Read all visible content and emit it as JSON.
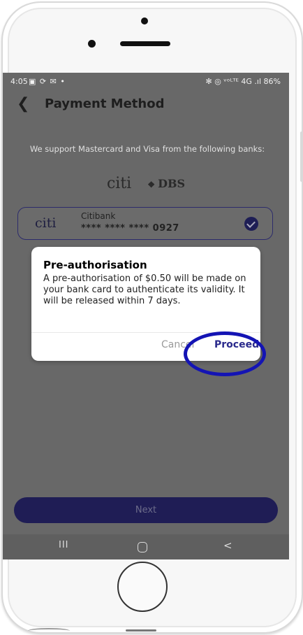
{
  "status_bar": {
    "time": "4:05",
    "left_icons": "▣ ⟳ ✉ •",
    "right_icons": "✻ ◎ ᵛᵒᴸᵀᴱ 4G .ıl",
    "battery": "86%"
  },
  "header": {
    "back_icon": "chevron-left-icon",
    "title": "Payment Method"
  },
  "support_text": "We support Mastercard and Visa from the following banks:",
  "bank_logos": {
    "citi": "citi",
    "dbs": "DBS"
  },
  "selected_card": {
    "logo": "citi",
    "bank_name": "Citibank",
    "masked_number": "**** **** ****",
    "last_four": "0927",
    "selected": true
  },
  "dialog": {
    "title": "Pre-authorisation",
    "body": "A pre-authorisation of $0.50 will be made on your bank card to authenticate its validity. It will be released within 7 days.",
    "cancel_label": "Cancel",
    "proceed_label": "Proceed"
  },
  "next_button": {
    "label": "Next"
  },
  "nav_bar": {
    "recent": "III",
    "back": "<"
  },
  "colors": {
    "accent": "#1f1d55",
    "highlight_ring": "#1414b4",
    "overlay": "#686868"
  }
}
